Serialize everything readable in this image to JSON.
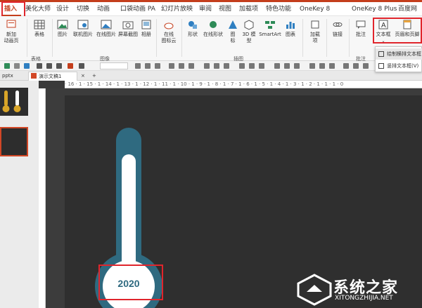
{
  "ribbon_tabs": {
    "insert": "插入",
    "beautify": "美化大师",
    "design": "设计",
    "transitions": "切换",
    "animations": "动画",
    "pocket_animation": "口袋动画 PA",
    "slideshow": "幻灯片放映",
    "review": "审阅",
    "view": "视图",
    "addins": "加载项",
    "special": "特色功能",
    "onekey8": "OneKey 8",
    "onekey8plus": "OneKey 8 Plus",
    "baidu": "百度网"
  },
  "ribbon": {
    "new_slide": "新加\n动画页",
    "table": "表格",
    "picture": "图片",
    "online_picture": "联机图片",
    "online_picture2": "在线图片",
    "screenshot": "屏幕截图",
    "album": "相册",
    "online_icons": "在线\n图标云",
    "shapes": "形状",
    "online_shapes": "在线形状",
    "icons": "图\n标",
    "model3d": "3D 模\n型",
    "smartart": "SmartArt",
    "chart": "图表",
    "addin_items": "加载\n项",
    "link": "链接",
    "comment": "批注",
    "textbox": "文本框",
    "header_footer": "页眉和页脚",
    "group_tables": "表格",
    "group_images": "图像",
    "group_illustrations": "插图",
    "group_comments": "批注"
  },
  "dropdown": {
    "horizontal": "绘制横排文本框",
    "vertical": "竖排文本框(V)"
  },
  "doc_tabs": {
    "tab1": "pptx",
    "tab2": "演示文稿1",
    "add": "+"
  },
  "ruler": {
    "ticks": "· 16 · 1 · 15 · 1 · 14 · 1 · 13 · 1 · 12 · 1 · 11 · 1 · 10 · 1 · 9 · 1 · 8 · 1 · 7 · 1 · 6 · 1 · 5 · 1 · 4 · 1 · 3 · 1 · 2 · 1 · 1 · 1 · 0"
  },
  "slide": {
    "year": "2020"
  },
  "watermark": {
    "cn": "系统之家",
    "en": "XITONGZHIJIA.NET"
  },
  "colors": {
    "accent": "#c43e1c",
    "highlight": "#e0252c",
    "thermo_outer": "#2f6a80",
    "thermo_inner": "#ffffff",
    "year_text": "#2f6a80"
  }
}
